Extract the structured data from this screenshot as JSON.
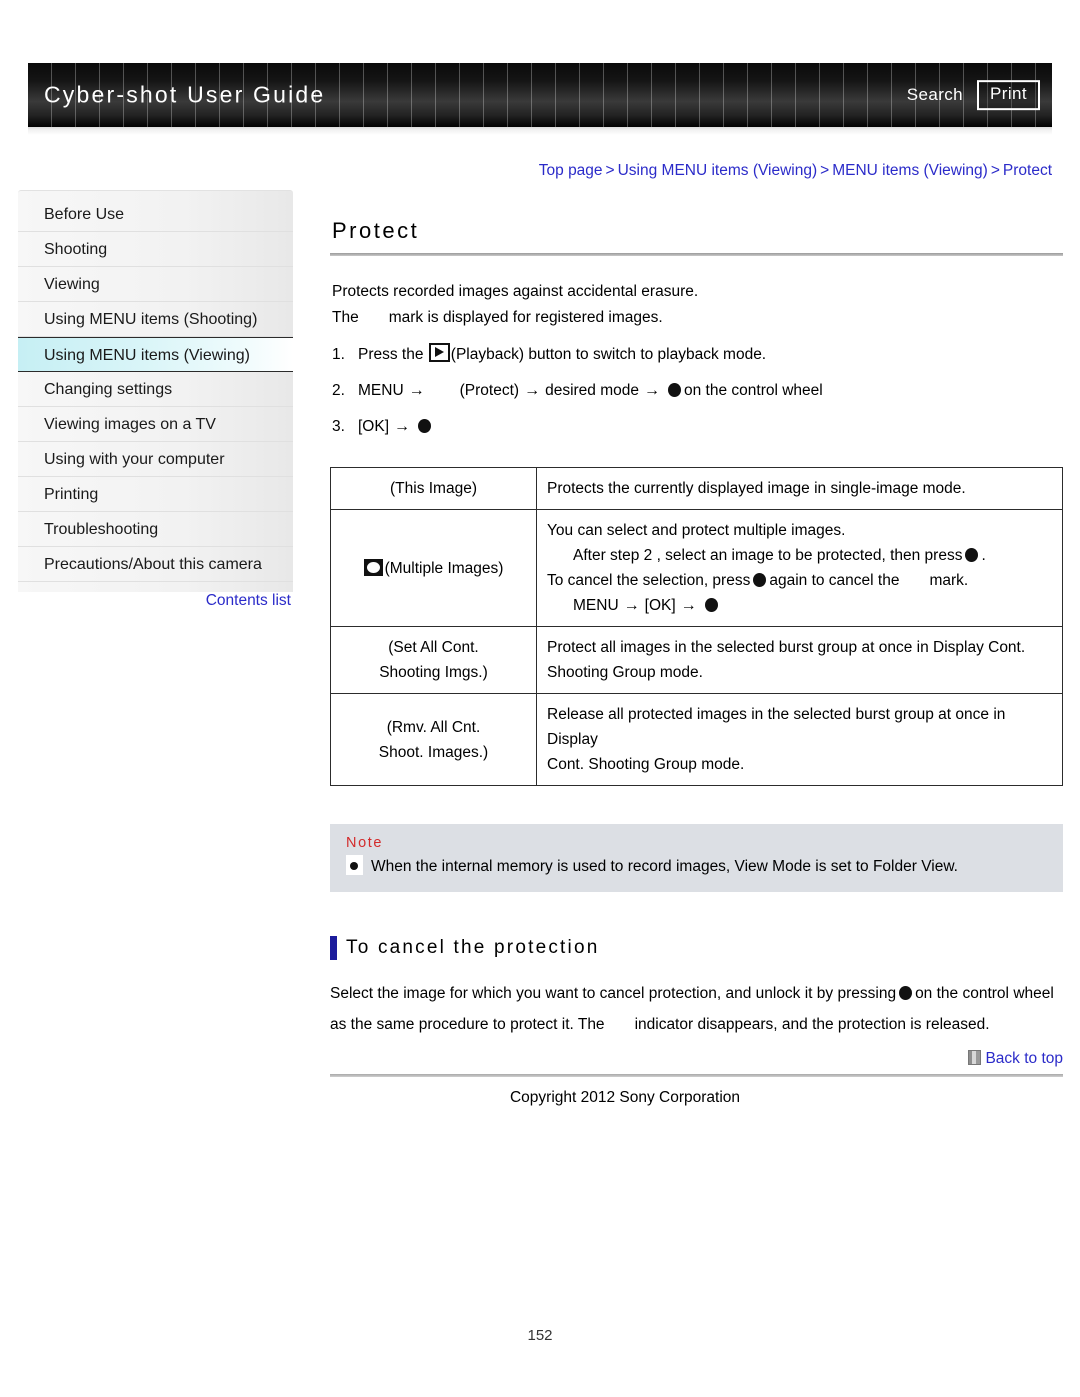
{
  "header": {
    "title": "Cyber-shot User Guide",
    "search_label": "Search",
    "print_label": "Print"
  },
  "breadcrumb": {
    "items": [
      "Top page",
      "Using MENU items (Viewing)",
      "MENU items (Viewing)",
      "Protect"
    ],
    "separator": ">",
    "color": "#2b2bc9"
  },
  "sidebar": {
    "items": [
      {
        "label": "Before Use",
        "selected": false
      },
      {
        "label": "Shooting",
        "selected": false
      },
      {
        "label": "Viewing",
        "selected": false
      },
      {
        "label": "Using MENU items (Shooting)",
        "selected": false
      },
      {
        "label": "Using MENU items (Viewing)",
        "selected": true
      },
      {
        "label": "Changing settings",
        "selected": false
      },
      {
        "label": "Viewing images on a TV",
        "selected": false
      },
      {
        "label": "Using with your computer",
        "selected": false
      },
      {
        "label": "Printing",
        "selected": false
      },
      {
        "label": "Troubleshooting",
        "selected": false
      },
      {
        "label": "Precautions/About this camera",
        "selected": false
      }
    ],
    "contents_link": "Contents list",
    "selected_color": "#c6eff4"
  },
  "main": {
    "title": "Protect",
    "intro_line1": "Protects recorded images against accidental erasure.",
    "intro_line2_pre": "The",
    "intro_line2_post": "mark is displayed for registered images.",
    "steps": [
      {
        "num": "1.",
        "pre": "Press the",
        "post": "(Playback) button to switch to playback mode."
      },
      {
        "num": "2.",
        "a": "MENU",
        "b": "(Protect)",
        "c": "desired mode",
        "d": "on the control wheel"
      },
      {
        "num": "3.",
        "a": "[OK]"
      }
    ],
    "table": {
      "rows": [
        {
          "icon": "none",
          "label_lines": [
            "(This Image)"
          ],
          "desc_lines": [
            "Protects the currently displayed image in single-image mode."
          ]
        },
        {
          "icon": "multiple-images-icon",
          "label_lines": [
            "(Multiple Images)"
          ],
          "desc_multi": {
            "l1": "You can select and protect multiple images.",
            "l2_pre": "After step 2 , select an image to be protected, then press",
            "l2_post": ".",
            "l3_pre": "To cancel the selection, press",
            "l3_mid": "again to cancel the",
            "l3_post": "mark.",
            "l4_a": "MENU",
            "l4_b": "[OK]"
          }
        },
        {
          "icon": "none",
          "label_lines": [
            "(Set All Cont.",
            "Shooting Imgs.)"
          ],
          "desc_lines": [
            "Protect all images in the selected burst group at once in Display Cont.",
            "Shooting Group mode."
          ]
        },
        {
          "icon": "none",
          "label_lines": [
            "(Rmv. All Cnt.",
            "Shoot. Images.)"
          ],
          "desc_lines": [
            "Release all protected images in the selected burst group at once in Display",
            "Cont. Shooting Group mode."
          ]
        }
      ]
    },
    "note": {
      "title": "Note",
      "title_color": "#d32b2b",
      "items": [
        "When the internal memory is used to record images, View Mode is set to Folder View."
      ]
    },
    "subsection": {
      "title": "To cancel the protection",
      "bar_color": "#1c1c9c",
      "line1_pre": "Select the image for which you want to cancel protection, and unlock it by pressing",
      "line1_post": "on the control",
      "line2_pre": "wheel as the same procedure to protect it. The",
      "line2_post": "indicator disappears, and the protection is released."
    },
    "back_to_top": "Back to top",
    "copyright": "Copyright 2012 Sony Corporation"
  },
  "footer": {
    "page_number": "152"
  }
}
